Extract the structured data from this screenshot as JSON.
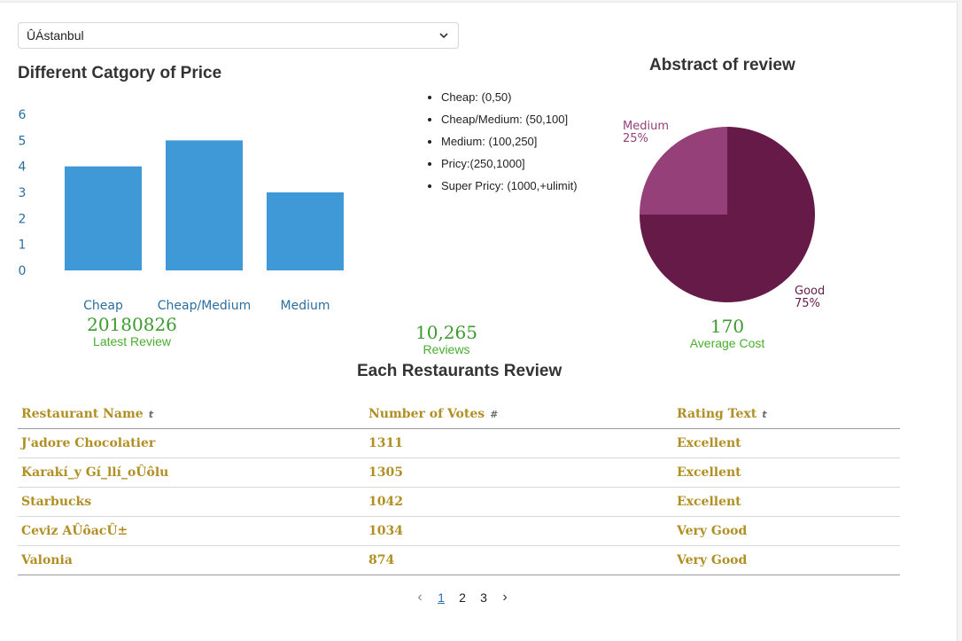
{
  "filter": {
    "selected": "ÛÁstanbul"
  },
  "bar_section": {
    "title": "Different Catgory of Price"
  },
  "price_legend": [
    "Cheap: (0,50)",
    "Cheap/Medium: (50,100]",
    "Medium: (100,250]",
    "Pricy:(250,1000]",
    "Super Pricy: (1000,+ulimit)"
  ],
  "pie_section": {
    "title": "Abstract of review"
  },
  "stats": [
    {
      "value": "20180826",
      "label": "Latest Review"
    },
    {
      "value": "10,265",
      "label": "Reviews"
    },
    {
      "value": "170",
      "label": "Average Cost"
    }
  ],
  "table": {
    "title": "Each Restaurants Review",
    "columns": [
      {
        "label": "Restaurant Name",
        "sort_icon": "t"
      },
      {
        "label": "Number of Votes",
        "sort_icon": "#"
      },
      {
        "label": "Rating Text",
        "sort_icon": "t"
      }
    ],
    "rows": [
      [
        "J'adore Chocolatier",
        "1311",
        "Excellent"
      ],
      [
        "Karakí_y Gí_llí_oÛôlu",
        "1305",
        "Excellent"
      ],
      [
        "Starbucks",
        "1042",
        "Excellent"
      ],
      [
        "Ceviz AÛôacÛ±",
        "1034",
        "Very Good"
      ],
      [
        "Valonia",
        "874",
        "Very Good"
      ]
    ]
  },
  "pagination": {
    "prev": "‹",
    "pages": [
      "1",
      "2",
      "3"
    ],
    "current": "1",
    "next": "›"
  },
  "colors": {
    "bar": "#3f99d6",
    "pie_good": "#651a48",
    "pie_medium": "#954078",
    "stat_green": "#3d9a2f",
    "table_gold": "#b18f24"
  },
  "chart_data": [
    {
      "type": "bar",
      "title": "Different Catgory of Price",
      "categories": [
        "Cheap",
        "Cheap/Medium",
        "Medium"
      ],
      "values": [
        4,
        5,
        3
      ],
      "ylim": [
        0,
        6
      ],
      "yticks": [
        0,
        1,
        2,
        3,
        4,
        5,
        6
      ],
      "grid": false
    },
    {
      "type": "pie",
      "title": "Abstract of review",
      "labels": [
        "Good",
        "Medium"
      ],
      "values": [
        75,
        25
      ],
      "value_labels": [
        "75%",
        "25%"
      ]
    }
  ]
}
